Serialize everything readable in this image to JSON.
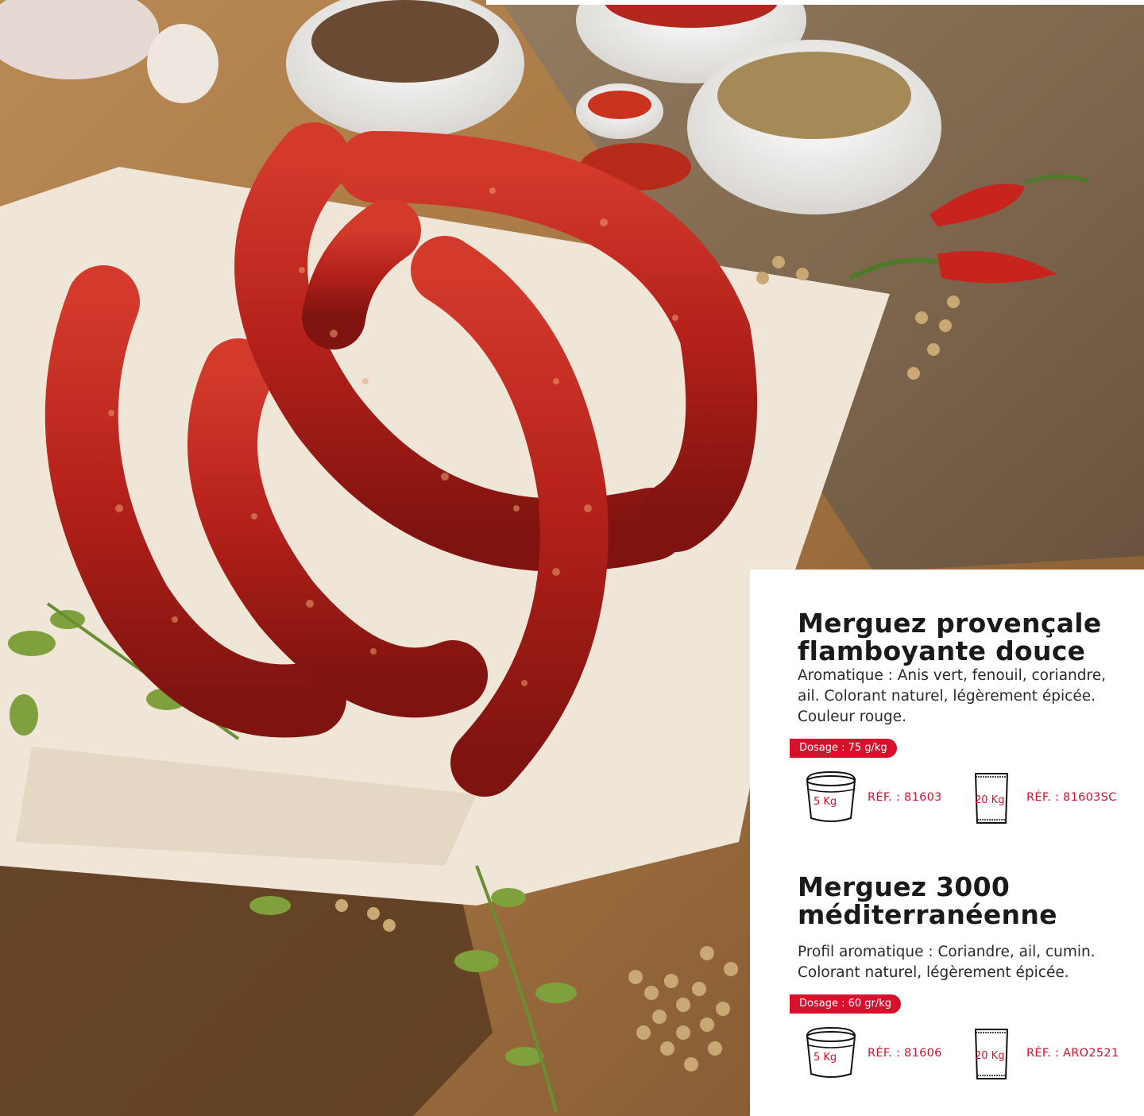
{
  "photo": {
    "subject": "sausage-photo"
  },
  "products": [
    {
      "title_line1": "Merguez provençale",
      "title_line2": "flamboyante douce",
      "description": "Aromatique : Anis vert, fenouil, coriandre, ail. Colorant naturel, légèrement épicée. Couleur rouge.",
      "dosage": "Dosage : 75 g/kg",
      "bucket_label": "5 Kg",
      "bucket_ref": "RÉF. : 81603",
      "sack_label": "20 Kg",
      "sack_ref": "RÉF. : 81603SC"
    },
    {
      "title_line1": "Merguez 3000",
      "title_line2": "méditerranéenne",
      "description": "Profil aromatique : Coriandre, ail, cumin. Colorant naturel, légèrement épicée.",
      "dosage": "Dosage : 60 gr/kg",
      "bucket_label": "5 Kg",
      "bucket_ref": "RÉF. : 81606",
      "sack_label": "20 Kg",
      "sack_ref": "RÉF. : ARO2521"
    }
  ],
  "colors": {
    "accent": "#d8102b",
    "text": "#1a1a1a"
  }
}
